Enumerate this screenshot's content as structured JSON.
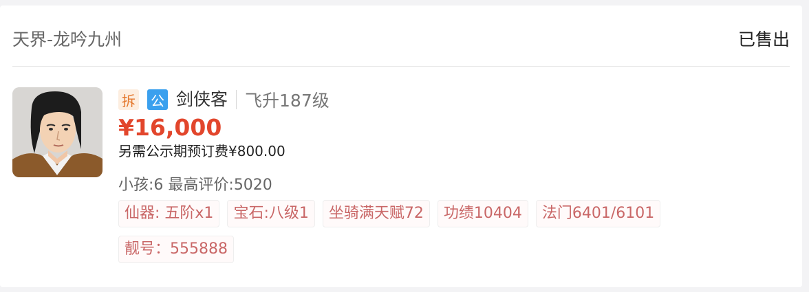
{
  "header": {
    "server": "天界-龙吟九州",
    "status": "已售出"
  },
  "item": {
    "badges": {
      "chai": "拆",
      "gong": "公"
    },
    "role": "剑侠客",
    "level": "飞升187级",
    "price": "¥16,000",
    "fee_note": "另需公示期预订费¥800.00",
    "stats": "小孩:6 最高评价:5020",
    "tags": [
      "仙器: 五阶x1",
      "宝石:八级1",
      "坐骑满天赋72",
      "功绩10404",
      "法门6401/6101",
      "靓号：555888"
    ]
  },
  "colors": {
    "price": "#e2462c",
    "tag_text": "#c96767",
    "badge_chai_bg": "#fdeee0",
    "badge_gong_bg": "#3aa0ee"
  }
}
